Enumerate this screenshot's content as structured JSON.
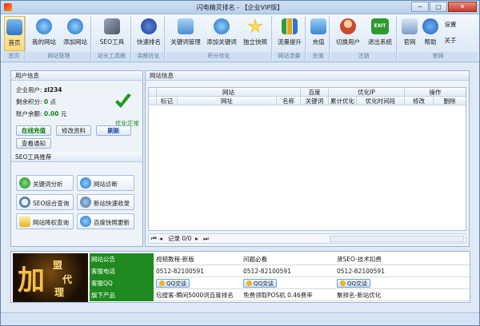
{
  "window": {
    "title": "闪电精灵排名 - 【企业VIP版】"
  },
  "toolbar": {
    "home": "首页",
    "my_site": "我的网站",
    "add_site": "添加网站",
    "seo_tool": "SEO工具",
    "fast_rank": "快速排名",
    "kw_manage": "关键词管理",
    "add_kw": "添加关键词",
    "solo_snapshot": "独立快照",
    "traffic_up": "流量提升",
    "recharge": "充值",
    "switch_user": "切换用户",
    "exit": "退出系统",
    "official": "官网",
    "help": "帮助",
    "settings": "设置",
    "about": "关于",
    "exit_icon_text": "EXIT"
  },
  "groups": {
    "home": "首页",
    "site_mgmt": "网站管理",
    "site_tools": "站长工具箱",
    "rank_opt": "余额优化",
    "points_opt": "积分优化",
    "traffic": "网站流量",
    "recharge": "充值",
    "logout": "注销",
    "official": "官网"
  },
  "user": {
    "header": "用户信息",
    "company_label": "企业用户:",
    "company_value": "zl234",
    "points_label": "剩余积分:",
    "points_value": "0",
    "points_unit": "点",
    "balance_label": "账户余额:",
    "balance_value": "0.00",
    "balance_unit": "元",
    "status": "优化正常",
    "recharge_btn": "在线充值",
    "edit_btn": "修改资料",
    "refresh_btn": "刷新",
    "notice_btn": "查看通知"
  },
  "seo_tools": {
    "header": "SEO工具推荐",
    "items": [
      "关键词分析",
      "网站诊断",
      "SEO综合查询",
      "新站快速收录",
      "网站降权查询",
      "百度快照更新"
    ]
  },
  "site_info": {
    "header": "网站信息",
    "group_headers": [
      "网站",
      "百度",
      "优化IP",
      "操作"
    ],
    "columns": [
      "标记",
      "网址",
      "名称",
      "关键词",
      "累计优化",
      "优化时间段",
      "修改",
      "删除"
    ],
    "pager_text": "记录 0/0"
  },
  "banner": {
    "big": "加",
    "c1": "盟",
    "c2": "代",
    "c3": "理"
  },
  "info_table": {
    "rows": [
      {
        "key": "网站公告",
        "cells": [
          "视频教程-新版",
          "问题必看",
          "贤SEO-技术扣费"
        ]
      },
      {
        "key": "客服电话",
        "cells": [
          "0512-82100591",
          "0512-82100591",
          "0512-82100591"
        ]
      },
      {
        "key": "客服QQ",
        "cells": [
          "QQ交谈",
          "QQ交谈",
          "QQ交谈"
        ]
      },
      {
        "key": "旗下产品",
        "cells": [
          "包搜客-瞬间5000词百度排名",
          "免费领取POS机 0.46费率",
          "聚排名-新站优化"
        ]
      }
    ]
  },
  "colors": {
    "accent": "#1f8a1f",
    "window": "#dfe9f5",
    "header": "#cfe0f3"
  }
}
